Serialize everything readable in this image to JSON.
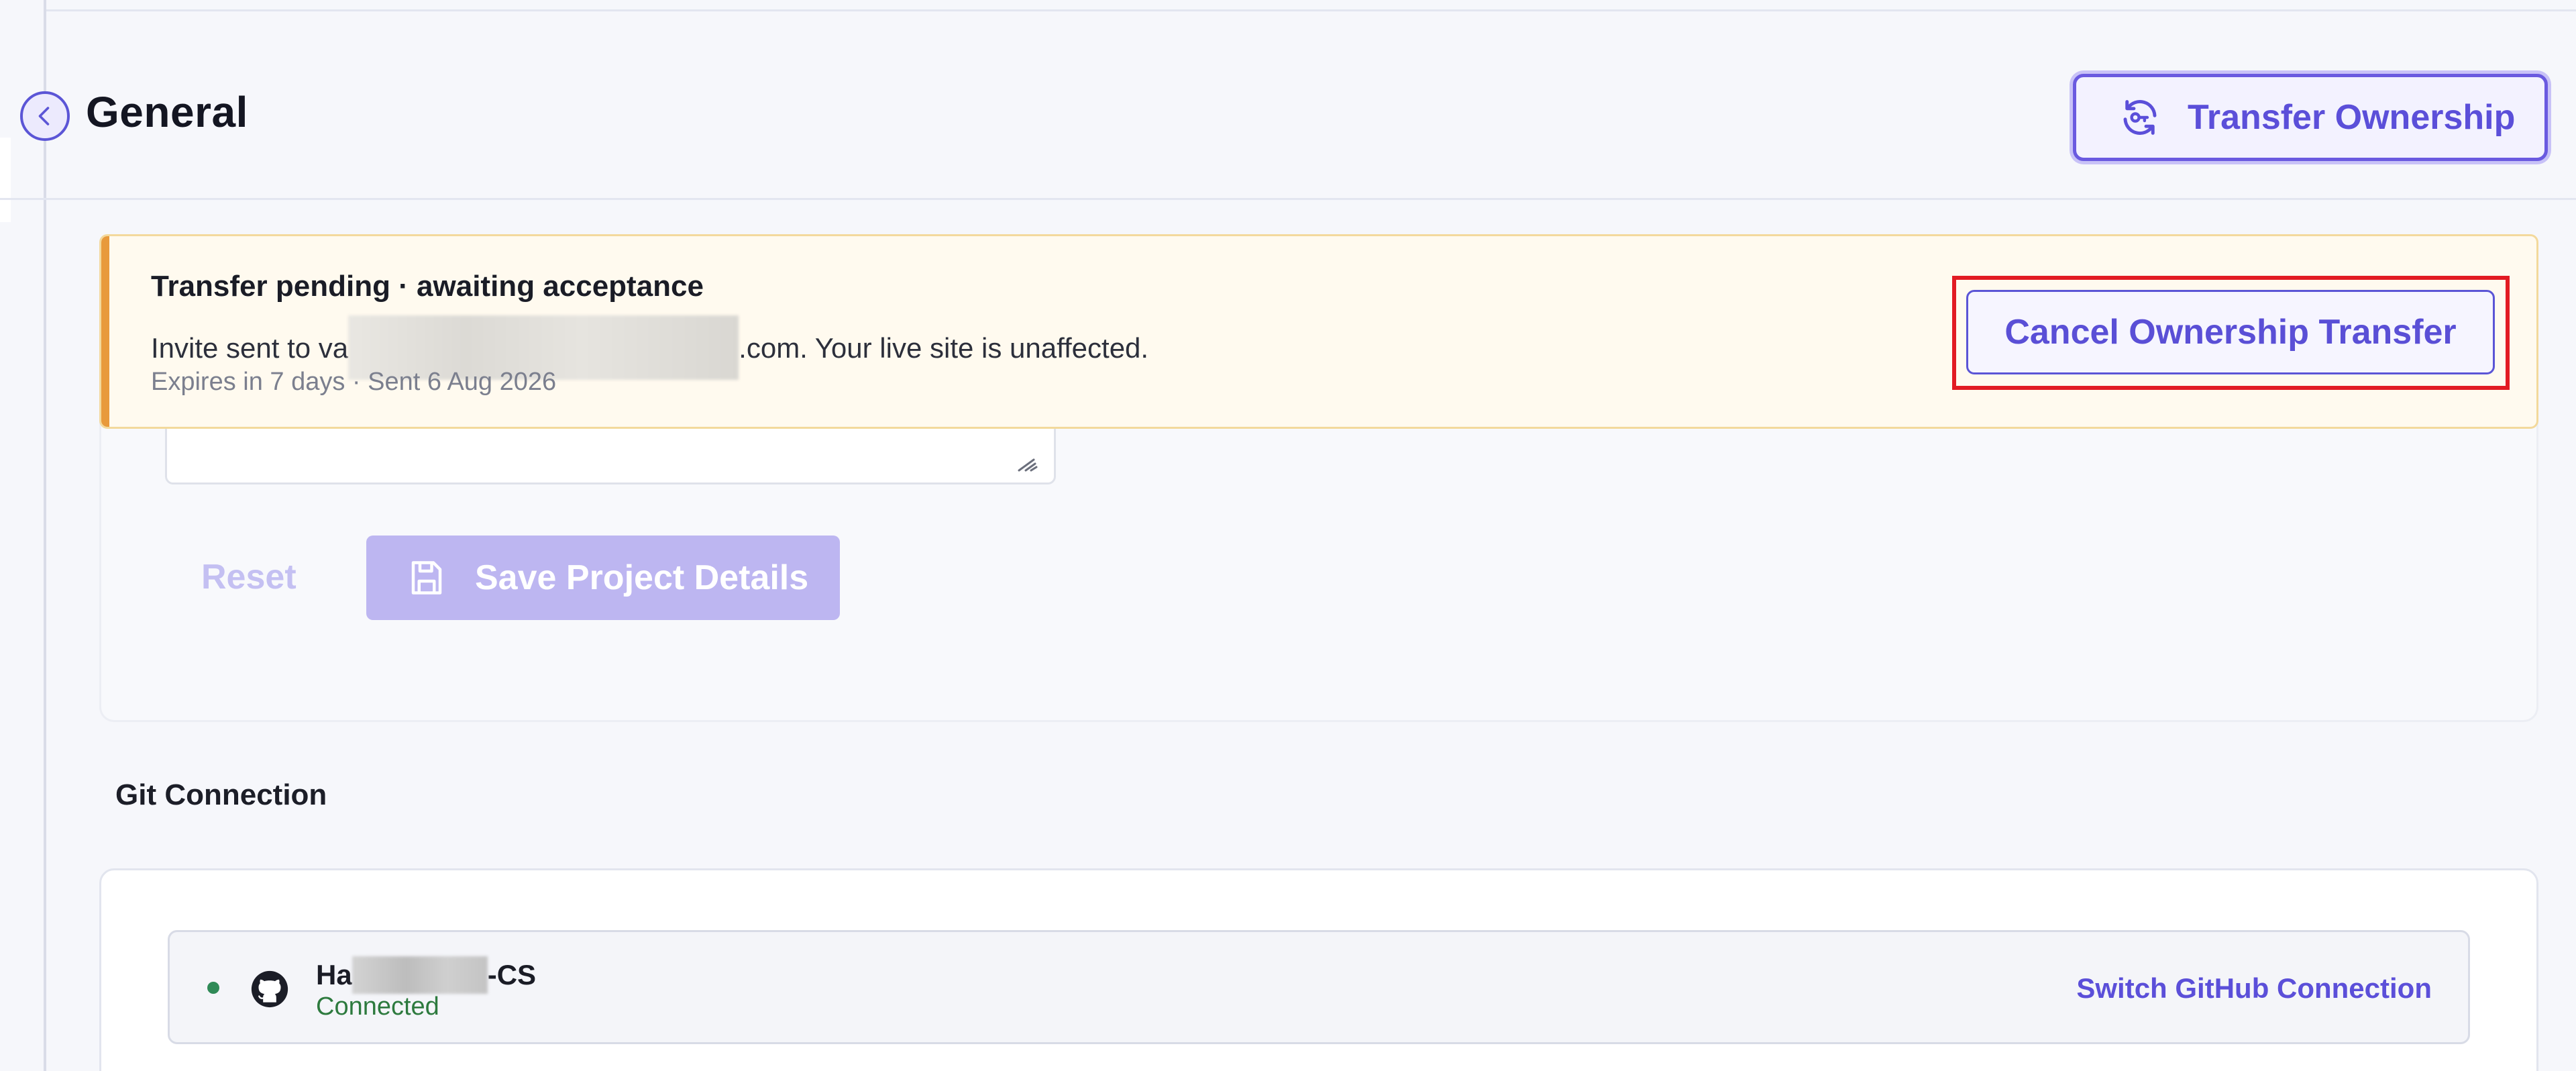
{
  "header": {
    "title": "General",
    "transfer_button_label": "Transfer Ownership"
  },
  "banner": {
    "title": "Transfer pending · awaiting acceptance",
    "message_prefix": "Invite sent to va",
    "message_suffix": ".com. Your live site is unaffected.",
    "meta": "Expires in 7 days · Sent 6 Aug 2026",
    "cancel_button_label": "Cancel Ownership Transfer"
  },
  "project_form": {
    "reset_label": "Reset",
    "save_label": "Save Project Details"
  },
  "git": {
    "section_title": "Git Connection",
    "repo_name_prefix": "Ha",
    "repo_name_suffix": "-CS",
    "status": "Connected",
    "switch_label": "Switch GitHub Connection"
  },
  "colors": {
    "accent": "#5b4fd9",
    "banner_accent": "#e89a3c",
    "connected": "#2d7a3e",
    "highlight": "#e21b23"
  }
}
